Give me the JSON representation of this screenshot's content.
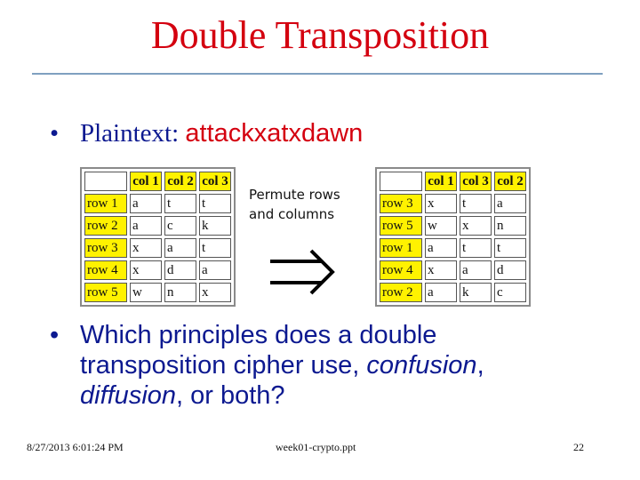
{
  "slide": {
    "title": "Double Transposition",
    "bullets": [
      {
        "bullet": "•",
        "label": "Plaintext: ",
        "value": "attackxatxdawn"
      },
      {
        "bullet": "•",
        "line1": "Which principles does a double",
        "line2_a": "transposition cipher use, ",
        "line2_em": "confusion",
        "line2_b": ",",
        "line3_em": "diffusion",
        "line3_b": ", or both?"
      }
    ],
    "annotation": {
      "line1": "Permute rows",
      "line2": "and columns",
      "arrow": "⇒"
    },
    "colors": {
      "title": "#d4000f",
      "body": "#0c1990",
      "highlight": "#fff200",
      "divider": "#7fa0c0"
    }
  },
  "tables": {
    "original": {
      "columns": [
        "col 1",
        "col 2",
        "col 3"
      ],
      "rows": [
        {
          "label": "row 1",
          "cells": [
            "a",
            "t",
            "t"
          ]
        },
        {
          "label": "row 2",
          "cells": [
            "a",
            "c",
            "k"
          ]
        },
        {
          "label": "row 3",
          "cells": [
            "x",
            "a",
            "t"
          ]
        },
        {
          "label": "row 4",
          "cells": [
            "x",
            "d",
            "a"
          ]
        },
        {
          "label": "row 5",
          "cells": [
            "w",
            "n",
            "x"
          ]
        }
      ]
    },
    "permuted": {
      "columns": [
        "col 1",
        "col 3",
        "col 2"
      ],
      "rows": [
        {
          "label": "row 3",
          "cells": [
            "x",
            "t",
            "a"
          ]
        },
        {
          "label": "row 5",
          "cells": [
            "w",
            "x",
            "n"
          ]
        },
        {
          "label": "row 1",
          "cells": [
            "a",
            "t",
            "t"
          ]
        },
        {
          "label": "row 4",
          "cells": [
            "x",
            "a",
            "d"
          ]
        },
        {
          "label": "row 2",
          "cells": [
            "a",
            "k",
            "c"
          ]
        }
      ]
    }
  },
  "footer": {
    "date": "8/27/2013 6:01:24 PM",
    "file": "week01-crypto.ppt",
    "page": "22"
  }
}
